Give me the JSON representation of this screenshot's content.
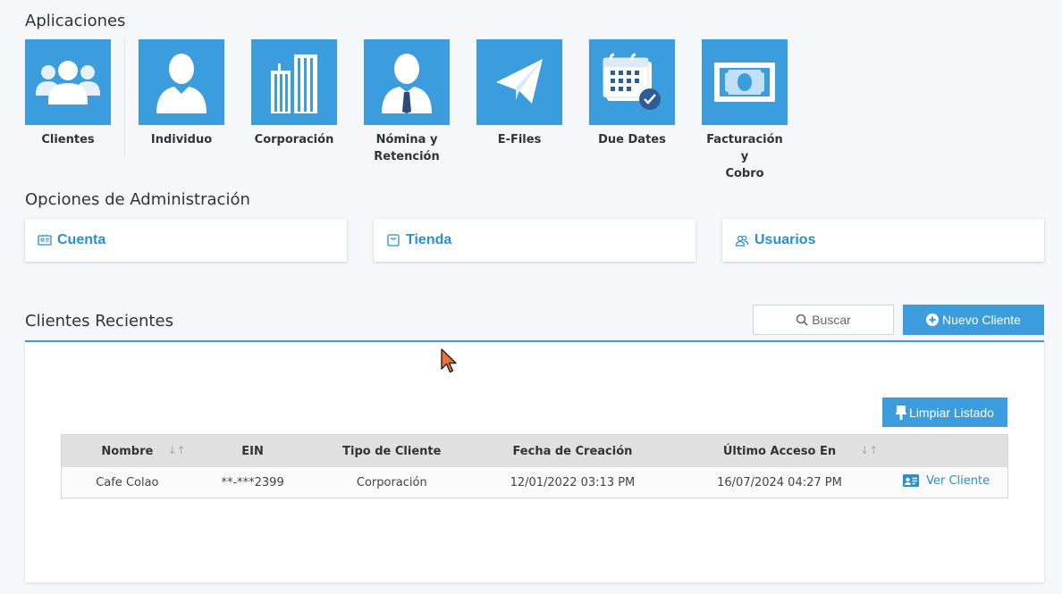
{
  "sections": {
    "applications": "Aplicaciones",
    "admin": "Opciones de Administración",
    "recent": "Clientes Recientes"
  },
  "apps": [
    {
      "label_line1": "Clientes",
      "label_line2": "",
      "icon": "clients-group-icon"
    },
    {
      "label_line1": "Individuo",
      "label_line2": "",
      "icon": "person-icon"
    },
    {
      "label_line1": "Corporación",
      "label_line2": "",
      "icon": "building-icon"
    },
    {
      "label_line1": "Nómina y",
      "label_line2": "Retención",
      "icon": "businessman-icon"
    },
    {
      "label_line1": "E-Files",
      "label_line2": "",
      "icon": "paper-plane-icon"
    },
    {
      "label_line1": "Due Dates",
      "label_line2": "",
      "icon": "calendar-check-icon"
    },
    {
      "label_line1": "Facturación y",
      "label_line2": "Cobro",
      "icon": "banknote-icon"
    }
  ],
  "admin_cards": [
    {
      "label": "Cuenta",
      "icon": "id-card-icon"
    },
    {
      "label": "Tienda",
      "icon": "shopping-bag-icon"
    },
    {
      "label": "Usuarios",
      "icon": "users-icon"
    }
  ],
  "toolbar": {
    "search_label": "Buscar",
    "new_client_label": "Nuevo Cliente",
    "clear_list_label": "Limpiar Listado"
  },
  "table": {
    "headers": [
      "Nombre",
      "EIN",
      "Tipo de Cliente",
      "Fecha de Creación",
      "Último Acceso En",
      ""
    ],
    "rows": [
      {
        "name": "Cafe Colao",
        "ein": "**-***2399",
        "type": "Corporación",
        "created": "12/01/2022 03:13 PM",
        "last_access": "16/07/2024 04:27 PM",
        "action": "Ver Cliente"
      }
    ]
  },
  "colors": {
    "accent": "#3b9ddd",
    "link": "#2a8fd0",
    "background": "#f5f7fa",
    "cursor": "#e8733a"
  }
}
